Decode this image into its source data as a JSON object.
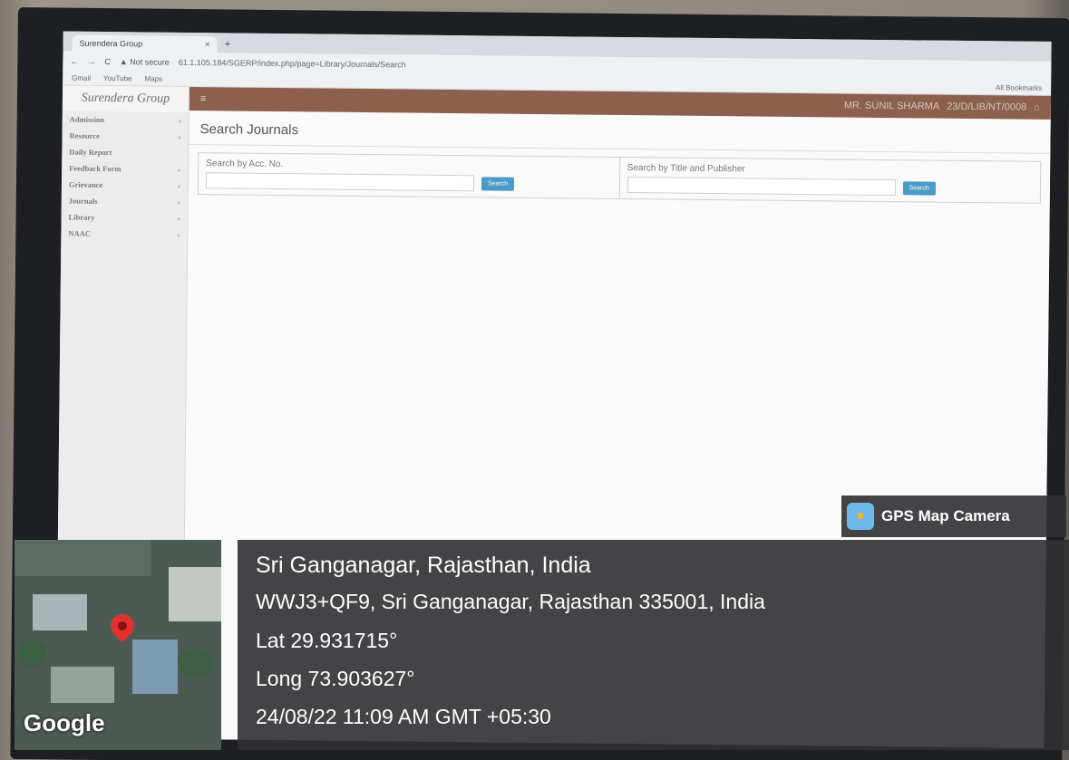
{
  "browser": {
    "tab_title": "Surendera Group",
    "tab_close": "×",
    "new_tab": "+",
    "nav_buttons": [
      "←",
      "→",
      "C"
    ],
    "security_label": "▲ Not secure",
    "url": "61.1.105.184/SGERP/index.php/page=Library/Journals/Search",
    "bookmarks": [
      "Gmail",
      "YouTube",
      "Maps"
    ],
    "bookmarks_right": "All Bookmarks"
  },
  "app": {
    "brand": "Surendera Group",
    "menu_toggle": "≡",
    "user_info": "MR. SUNIL SHARMA",
    "user_id": "23/D/LIB/NT/0008",
    "home_icon": "⌂",
    "sidebar_items": [
      {
        "label": "Admission"
      },
      {
        "label": "Resource"
      },
      {
        "label": "Daily Report"
      },
      {
        "label": "Feedback Form"
      },
      {
        "label": "Grievance"
      },
      {
        "label": "Journals"
      },
      {
        "label": "Library"
      },
      {
        "label": "NAAC"
      }
    ],
    "chevron": "‹",
    "page_title": "Search Journals",
    "search_acc_label": "Search by Acc. No.",
    "search_acc_button": "Search",
    "search_title_label": "Search by Title and Publisher",
    "search_title_button": "Search"
  },
  "gps": {
    "app_name": "GPS Map Camera",
    "location": "Sri Ganganagar, Rajasthan, India",
    "address": "WWJ3+QF9, Sri Ganganagar, Rajasthan 335001, India",
    "lat": "Lat 29.931715°",
    "long": "Long 73.903627°",
    "datetime": "24/08/22 11:09 AM GMT +05:30",
    "map_brand": "Google"
  }
}
